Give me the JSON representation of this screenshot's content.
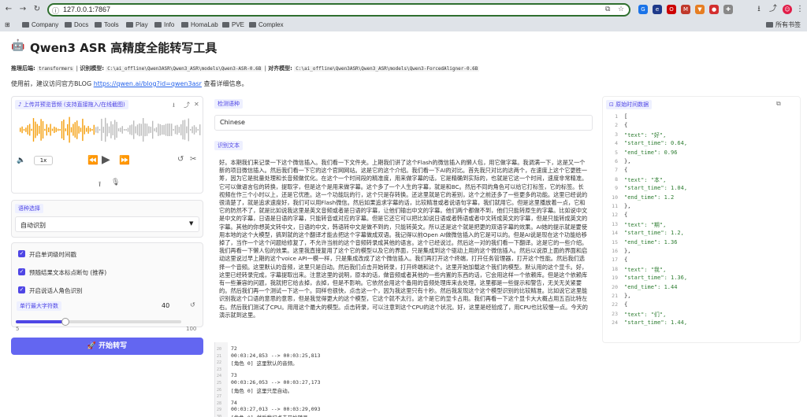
{
  "browser": {
    "url": "127.0.0.1:7867",
    "bookmarks": [
      "Company",
      "Docs",
      "Tools",
      "Play",
      "Info",
      "HomaLab",
      "PVE",
      "Complex"
    ],
    "all_bookmarks": "所有书签"
  },
  "header": {
    "title": "Qwen3 ASR 高精度全能转写工具",
    "backend_label": "推理后端:",
    "backend_value": "transformers",
    "model_label": "识别模型:",
    "model_value": "C:\\ai_offline\\Qwen3ASR\\Qwen3_ASR\\models\\Qwen3-ASR-0.6B",
    "aligner_label": "对齐模型:",
    "aligner_value": "C:\\ai_offline\\Qwen3ASR\\Qwen3_ASR\\models\\Qwen3-ForcedAligner-0.6B",
    "notice_prefix": "使用前，建议访问官方BLOG ",
    "notice_link": "https://qwen.ai/blog?id=qwen3asr",
    "notice_suffix": " 查看详细信息。"
  },
  "left": {
    "upload_label": "上传并预览音频 (支持直接拖入/在线截图)",
    "speed": "1x",
    "lang_label": "语种选择",
    "lang_value": "自动识别",
    "options": [
      "开启单词级时间戳",
      "预随结果文本标点断句 (推荐)",
      "开启说话人角色识别"
    ],
    "max_chars_label": "单行最大字符数",
    "max_chars_value": "40",
    "max_chars_fraction": 0.3,
    "slider_min": "5",
    "slider_max": "100",
    "start_button": "🚀 开始转写"
  },
  "middle": {
    "detected_lang_label": "检测语种",
    "detected_lang_value": "Chinese",
    "text_label": "识别文本",
    "text": "好。本期我们来记录一下这个微信插入。我们看一下文件夹。上期我们讲了这个Flash的微信插入的懒人包，用它做字幕。我调满一下，这是又一个新的项目微信插入。然后我们看一下它的这个官网网站。这是它的这个介绍。我们看一下AI的对比。首先我只对比的这两个，在速度上这个它更胜一筹，因为它是批量处理和长音频做优化。在这个一个时间段的精准度，用来做字幕的话，它是精确到实际的，也就是它这一个时间，速度非常精准。它可以做语言包的转换，提取字，但是这个是用来做字幕。这个多了一个人生的字幕，就是和BC。然后不同的角色可以给它打标签，它的标签。长视频在作三个小时以上，还是它优胜。这一个功能玩的行，这个只是存转换。还这里就是它的差别，这个之前还多了一些更多的功能。这里已经说的很清楚了，就是追求速度好，我们可以用Flash微信。然后如果追求字幕的话，比较精准或者说语句字幕，我们就用它。但是这里播放着一点，它和它的防然不了，就是比如说我这里是英文音频或者是日语的字幕，让他们输出中文的字幕。他们两个都做不到，他们只能转原生的字幕。比如说中文是中文的字幕，日语是日语的字幕，只能转音或对应的字幕。但是它还它可以把比如说日语或者韩语或者中文转成英文的字幕，但是只能转成英文的字幕。其他的你想英文转中文，日语的中文，韩语转中文是做不到的，只能转英文。所以还是这个就是把更的双语字幕的效果。AI她的提示就是要使用本地的这个大模型，搞到就的这个翻译才能去把这个字幕做成双语。我记得以前Open AI做微信插入的它是可以的。但是AI说是现在这个功能给移掉了，当作一个这个问题给修复了，不允许当前的这个音频转录成其他的语言。这个已经说过。然后这一对的我们看一下翻译。这是它的一些介绍。我们再看一下懒人包的效果。这里我直接复用了这个它的模型以及它的界面，只是集成到这个驱动上用的这个微信插入。然后以说原上面的界面和启动这里说过早上期的这个voice API一模一样，只是集成改成了这个微信插入。我们再打开这个终端，打开任务管理器，打开这个性能。然后我们选择一个音频。这里默认的音频，这里只是自动。然后我们点击开始转录，打开终端和这个。这里开始加载这个我们的模型。默认用的这个显卡。好，这里已经转录完成，字幕提取出来。注意这里的说明，原本的话，做音频或者其他的一些内置的东西的话，它会用这样一个依赖库。但是这个依赖库有一些兼容的问题，我就把它给去掉，去掉，但是不影响。它依然会用这个备用的音频处理库来去处理。这里都是一些提示和警告，无关无关紧要的。然后我们再一个测试一下这一个。同样也很快，点击这一个，因为我这里只有十秒。然后我发现这个这个模型识别的比较精准。比如说它这里能识别我这个口语的意思的意思，但是我觉得更大的这个模型，它这个就不太行。这个是它的显卡占用。我们再看一下这个显卡大大概占用五百比特左右。然后我们测试了CPU。用用这个最大的模型。点击转录，可以注意到这个CPU的这个状况。好，这里是经验成了，用CPU也比较慢一点。今天的演示就到这里。"
  },
  "srt": {
    "line_numbers": [
      "20",
      "21",
      "22",
      "23",
      "24",
      "25",
      "26",
      "27",
      "28",
      "29",
      "30"
    ],
    "lines": [
      "72",
      "00:03:24,853 --> 00:03:25,813",
      "[角色 0] 这里默认的音频。",
      "",
      "73",
      "00:03:26,053 --> 00:03:27,173",
      "[角色 0] 这里只是自动。",
      "",
      "74",
      "00:03:27,013 --> 00:03:29,093",
      "[角色 0] 然后我们点击开始转录，"
    ]
  },
  "right": {
    "label": "原始时间数据",
    "line_numbers": [
      "1",
      "2",
      "3",
      "4",
      "5",
      "6",
      "7",
      "8",
      "9",
      "10",
      "11",
      "12",
      "13",
      "14",
      "15",
      "16",
      "17",
      "18",
      "19",
      "20",
      "21",
      "22",
      "23",
      "24"
    ],
    "json_lines": [
      "[",
      "  {",
      "    \"text\": \"好\",",
      "    \"start_time\": 0.64,",
      "    \"end_time\": 0.96",
      "  },",
      "  {",
      "    \"text\": \"本\",",
      "    \"start_time\": 1.04,",
      "    \"end_time\": 1.2",
      "  },",
      "  {",
      "    \"text\": \"期\",",
      "    \"start_time\": 1.2,",
      "    \"end_time\": 1.36",
      "  },",
      "  {",
      "    \"text\": \"我\",",
      "    \"start_time\": 1.36,",
      "    \"end_time\": 1.44",
      "  },",
      "  {",
      "    \"text\": \"们\",",
      "    \"start_time\": 1.44,"
    ]
  }
}
